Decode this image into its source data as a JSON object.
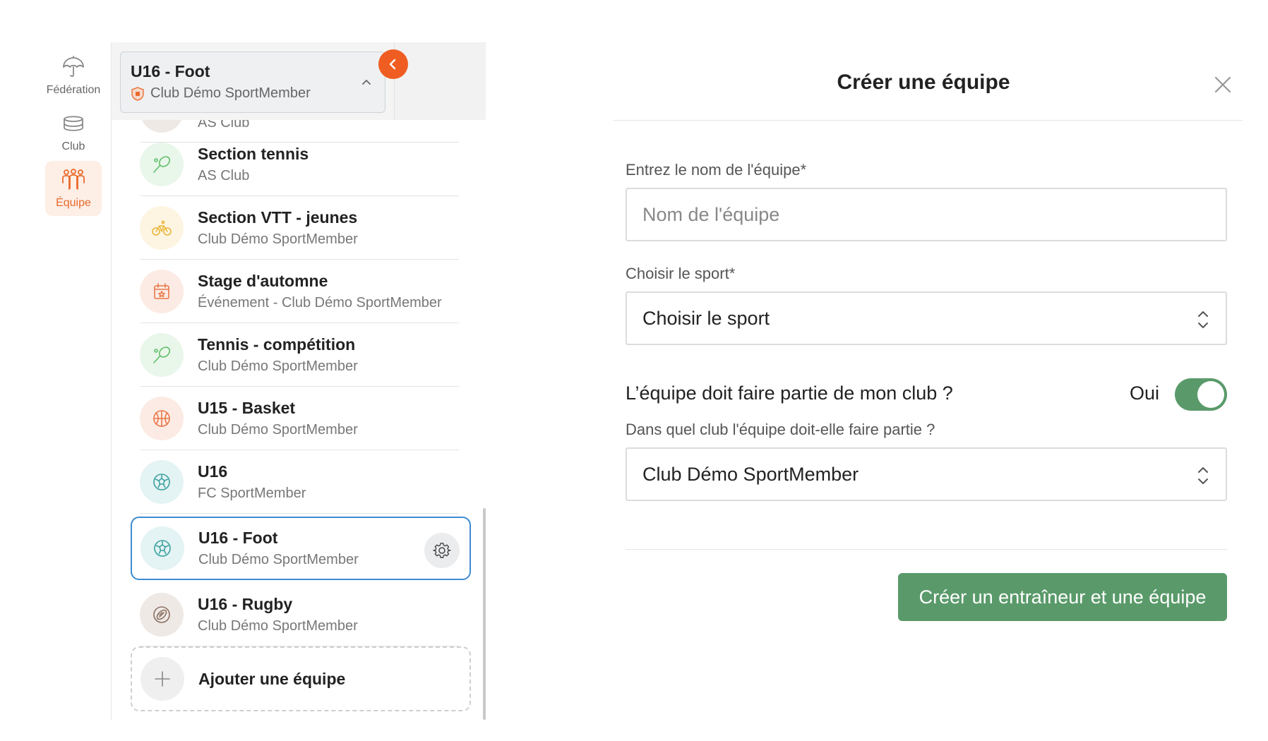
{
  "rail": {
    "items": [
      {
        "label": "Fédération",
        "icon": "umbrella-icon",
        "active": false
      },
      {
        "label": "Club",
        "icon": "club-icon",
        "active": false
      },
      {
        "label": "Équipe",
        "icon": "team-icon",
        "active": true
      }
    ]
  },
  "selector": {
    "current_name": "U16 - Foot",
    "current_club": "Club Démo SportMember",
    "partial_item_sub": "AS Club"
  },
  "teams": [
    {
      "name": "Section tennis",
      "sub": "AS Club",
      "icon": "tennis-icon",
      "color": "#5fbf6a",
      "bg": "#e9f6ea"
    },
    {
      "name": "Section VTT - jeunes",
      "sub": "Club Démo SportMember",
      "icon": "bike-icon",
      "color": "#e8b638",
      "bg": "#fdf5e2"
    },
    {
      "name": "Stage d'automne",
      "sub": "Événement - Club Démo SportMember",
      "icon": "calendar-icon",
      "color": "#e9774a",
      "bg": "#fcebe4"
    },
    {
      "name": "Tennis - compétition",
      "sub": "Club Démo SportMember",
      "icon": "tennis-icon",
      "color": "#5fbf6a",
      "bg": "#e9f6ea"
    },
    {
      "name": "U15 - Basket",
      "sub": "Club Démo SportMember",
      "icon": "basketball-icon",
      "color": "#e9774a",
      "bg": "#fcebe4"
    },
    {
      "name": "U16",
      "sub": "FC SportMember",
      "icon": "soccer-icon",
      "color": "#3a9fa0",
      "bg": "#e4f3f3"
    },
    {
      "name": "U16 - Foot",
      "sub": "Club Démo SportMember",
      "icon": "soccer-icon",
      "color": "#3a9fa0",
      "bg": "#e4f3f3",
      "selected": true
    },
    {
      "name": "U16 - Rugby",
      "sub": "Club Démo SportMember",
      "icon": "rugby-icon",
      "color": "#8a7060",
      "bg": "#efe9e6"
    }
  ],
  "add_team_label": "Ajouter une équipe",
  "modal": {
    "title": "Créer une équipe",
    "name_label": "Entrez le nom de l'équipe*",
    "name_placeholder": "Nom de l'équipe",
    "sport_label": "Choisir le sport*",
    "sport_value": "Choisir le sport",
    "toggle_label": "L’équipe doit faire partie de mon club ?",
    "toggle_value_label": "Oui",
    "toggle_on": true,
    "club_label": "Dans quel club l'équipe doit-elle faire partie ?",
    "club_value": "Club Démo SportMember",
    "submit_label": "Créer un entraîneur et une équipe"
  },
  "colors": {
    "accent_orange": "#ef5d22",
    "primary_green": "#5a9a6a",
    "selected_border": "#3d8bd1"
  }
}
